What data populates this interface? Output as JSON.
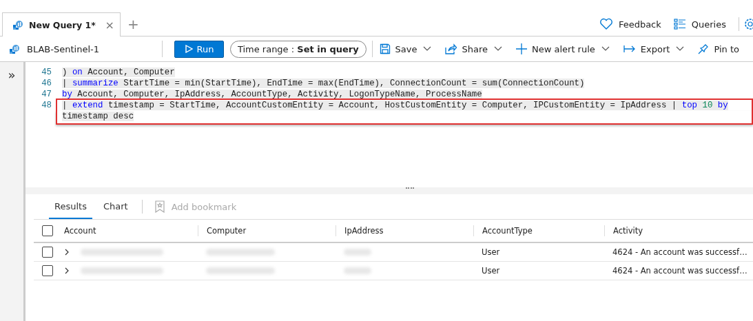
{
  "tabs": [
    {
      "label": "New Query 1*",
      "selected": true,
      "close": "×"
    }
  ],
  "add_tab": "+",
  "expand_glyph": "»",
  "header_actions": [
    {
      "kind": "heart",
      "label": "Feedback"
    },
    {
      "kind": "list",
      "label": "Queries"
    }
  ],
  "workspace": "BLAB-Sentinel-1",
  "run_button": "Run",
  "time_range": {
    "label": "Time range :",
    "value": "Set in query"
  },
  "toolbar": [
    {
      "kind": "save",
      "label": "Save",
      "dropdown": true
    },
    {
      "kind": "share",
      "label": "Share",
      "dropdown": true
    },
    {
      "kind": "plus",
      "label": "New alert rule",
      "dropdown": true
    },
    {
      "kind": "export",
      "label": "Export",
      "dropdown": true
    },
    {
      "kind": "pin",
      "label": "Pin to",
      "dropdown": false
    }
  ],
  "editor_lines": [
    {
      "number": "45",
      "highlighted": false,
      "segments": [
        {
          "kind": "plain",
          "text": ") "
        },
        {
          "kind": "keyword",
          "text": "on"
        },
        {
          "kind": "plain",
          "text": " Account, Computer"
        }
      ]
    },
    {
      "number": "46",
      "highlighted": false,
      "segments": [
        {
          "kind": "plain",
          "text": "| "
        },
        {
          "kind": "keyword",
          "text": "summarize"
        },
        {
          "kind": "plain",
          "text": " StartTime = min(StartTime), EndTime = max(EndTime), ConnectionCount = sum(ConnectionCount)"
        }
      ]
    },
    {
      "number": "47",
      "highlighted": false,
      "segments": [
        {
          "kind": "keyword",
          "text": "by"
        },
        {
          "kind": "plain",
          "text": " Account, Computer, IpAddress, AccountType, Activity, LogonTypeName, ProcessName"
        }
      ]
    },
    {
      "number": "48",
      "highlighted": true,
      "segments": [
        {
          "kind": "plain",
          "text": "| "
        },
        {
          "kind": "keyword",
          "text": "extend"
        },
        {
          "kind": "plain",
          "text": " timestamp = StartTime, AccountCustomEntity = Account, HostCustomEntity = Computer, IPCustomEntity = IpAddress | "
        },
        {
          "kind": "keyword",
          "text": "top"
        },
        {
          "kind": "number",
          "text": " 10"
        },
        {
          "kind": "keyword",
          "text": " by"
        }
      ]
    },
    {
      "highlighted": true,
      "segments": [
        {
          "kind": "plain",
          "text": "timestamp desc"
        }
      ]
    }
  ],
  "result_tabs": [
    {
      "label": "Results",
      "selected": true
    },
    {
      "label": "Chart",
      "selected": false
    }
  ],
  "add_bookmark": {
    "label": "Add bookmark",
    "disabled": true
  },
  "table": {
    "header_checked": false,
    "columns": [
      "Account",
      "Computer",
      "IpAddress",
      "AccountType",
      "Activity"
    ],
    "rows": [
      {
        "checked": false,
        "expanded": false,
        "account_type": "User",
        "activity": "4624 - An account was successf…"
      },
      {
        "checked": false,
        "expanded": false,
        "account_type": "User",
        "activity": "4624 - An account was successf…"
      }
    ]
  }
}
